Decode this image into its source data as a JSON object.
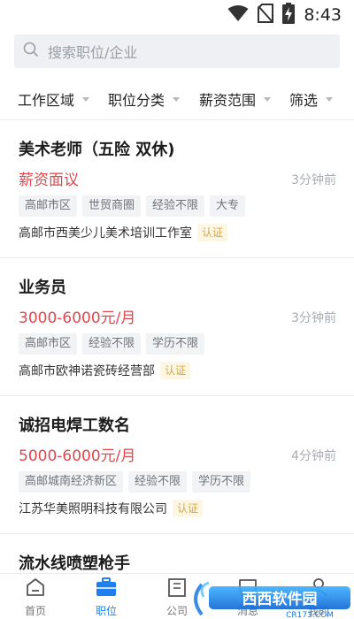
{
  "status_bar": {
    "time": "8:43"
  },
  "search": {
    "placeholder": "搜索职位/企业"
  },
  "filters": [
    {
      "label": "工作区域"
    },
    {
      "label": "职位分类"
    },
    {
      "label": "薪资范围"
    },
    {
      "label": "筛选"
    }
  ],
  "jobs": [
    {
      "title": "美术老师（五险 双休)",
      "salary": "薪资面议",
      "posted": "3分钟前",
      "tags": [
        "高邮市区",
        "世贸商圈",
        "经验不限",
        "大专"
      ],
      "company": "高邮市西美少儿美术培训工作室",
      "badge": "认证"
    },
    {
      "title": "业务员",
      "salary": "3000-6000元/月",
      "posted": "3分钟前",
      "tags": [
        "高邮市区",
        "经验不限",
        "学历不限"
      ],
      "company": "高邮市欧神诺瓷砖经营部",
      "badge": "认证"
    },
    {
      "title": "诚招电焊工数名",
      "salary": "5000-6000元/月",
      "posted": "4分钟前",
      "tags": [
        "高邮城南经济新区",
        "经验不限",
        "学历不限"
      ],
      "company": "江苏华美照明科技有限公司",
      "badge": "认证"
    },
    {
      "title": "流水线喷塑枪手"
    }
  ],
  "tabs": [
    {
      "label": "首页",
      "icon": "home-icon"
    },
    {
      "label": "职位",
      "icon": "briefcase-icon",
      "active": true
    },
    {
      "label": "公司",
      "icon": "building-icon"
    },
    {
      "label": "消息",
      "icon": "message-icon"
    },
    {
      "label": "我的",
      "icon": "user-icon"
    }
  ],
  "watermark": {
    "brand": "西西软件园",
    "url": "CR173.COM"
  },
  "colors": {
    "accent": "#1e7ff0",
    "salary": "#e0474c",
    "badge": "#d4a84b"
  }
}
